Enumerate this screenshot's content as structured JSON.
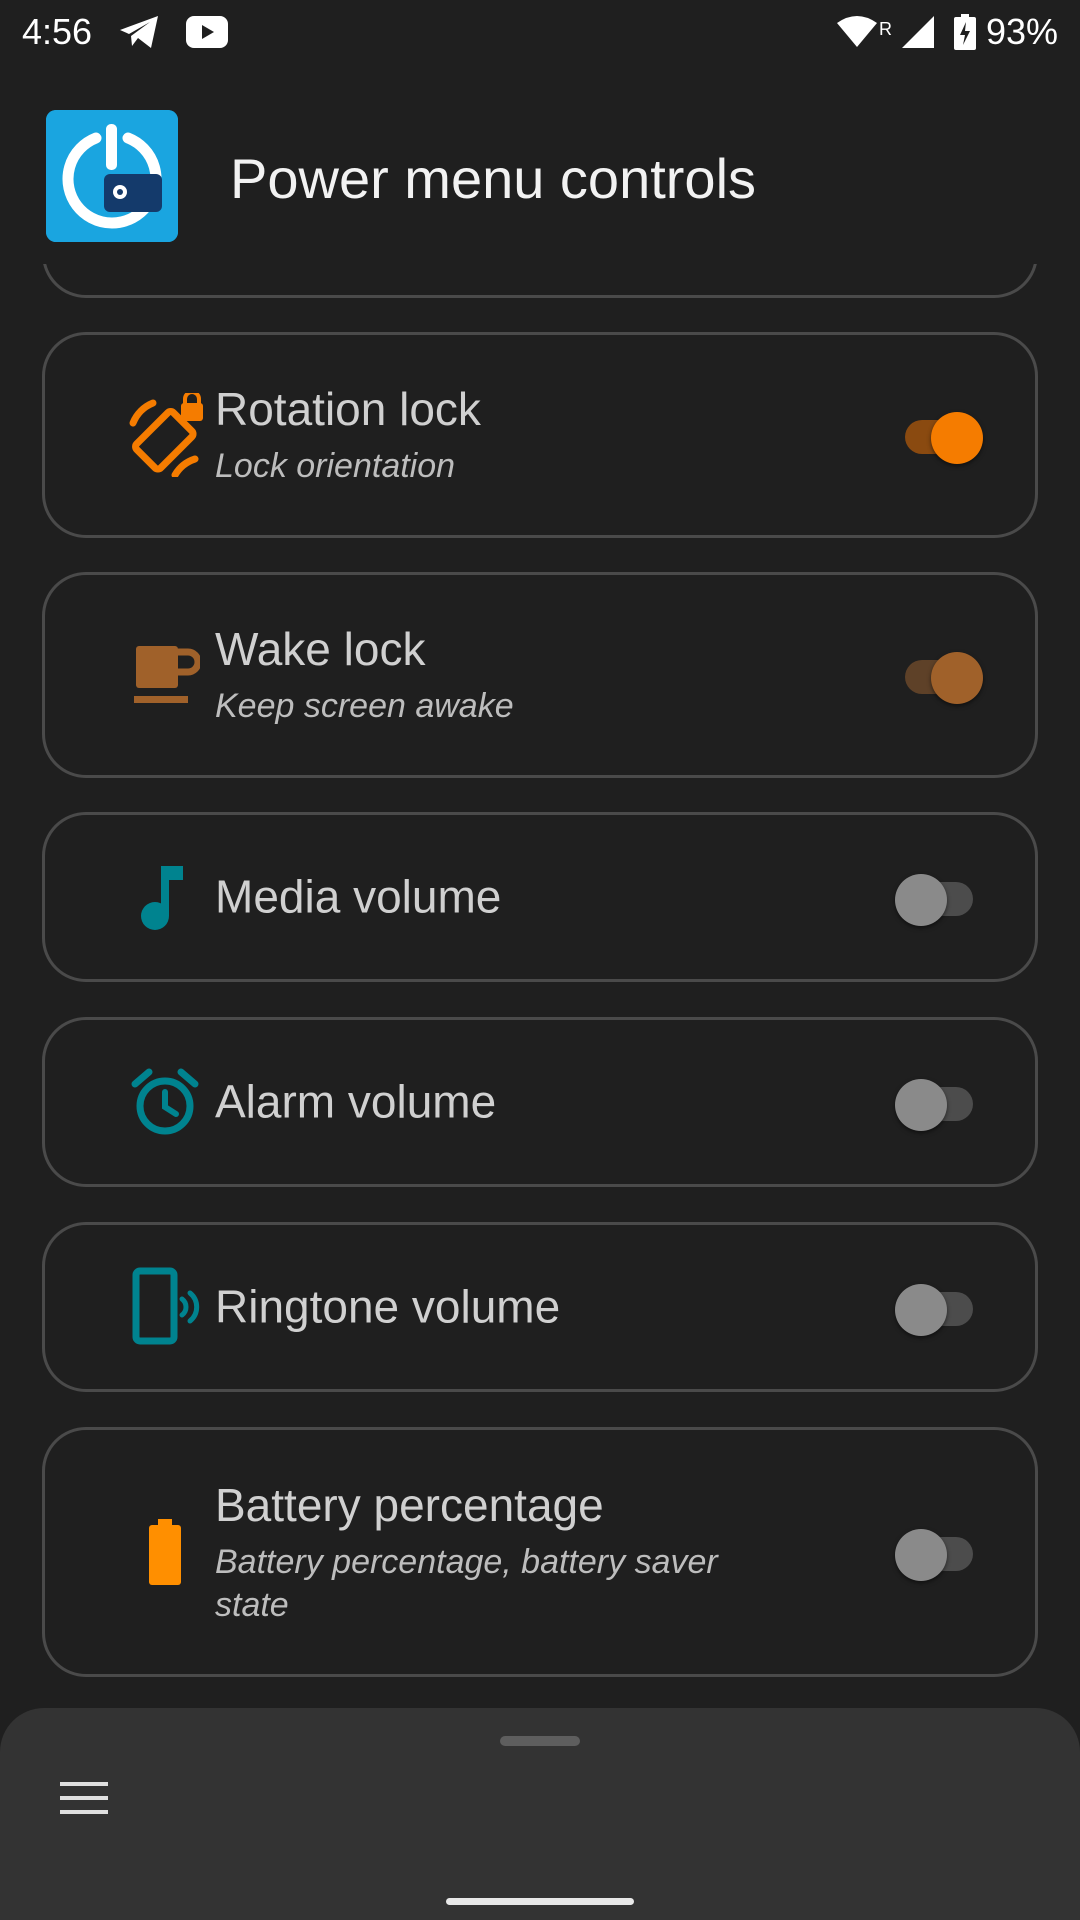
{
  "status_bar": {
    "time": "4:56",
    "battery_percent": "93%",
    "roaming_indicator": "R",
    "icons": [
      "telegram-icon",
      "youtube-icon",
      "wifi-icon",
      "signal-icon",
      "battery-charging-icon"
    ]
  },
  "header": {
    "title": "Power menu controls",
    "logo_icon": "power-settings-icon"
  },
  "items": [
    {
      "title": "Rotation lock",
      "subtitle": "Lock orientation",
      "icon": "screen-rotation-lock-icon",
      "enabled": true
    },
    {
      "title": "Wake lock",
      "subtitle": "Keep screen awake",
      "icon": "coffee-cup-icon",
      "enabled": true
    },
    {
      "title": "Media volume",
      "icon": "music-note-icon",
      "enabled": false
    },
    {
      "title": "Alarm volume",
      "icon": "alarm-clock-icon",
      "enabled": false
    },
    {
      "title": "Ringtone volume",
      "icon": "phone-ringing-icon",
      "enabled": false
    },
    {
      "title": "Battery percentage",
      "subtitle": "Battery percentage, battery saver state",
      "icon": "battery-icon",
      "enabled": false
    }
  ],
  "bottom_sheet": {
    "menu_icon": "hamburger-menu-icon"
  },
  "colors": {
    "background": "#1f1f1f",
    "card_border": "#4a4a4a",
    "orange_accent": "#f57c00",
    "brown_accent": "#a0612a",
    "teal_icon": "#00838f",
    "battery_orange": "#ff8f00",
    "logo_blue": "#1aa5e0"
  }
}
